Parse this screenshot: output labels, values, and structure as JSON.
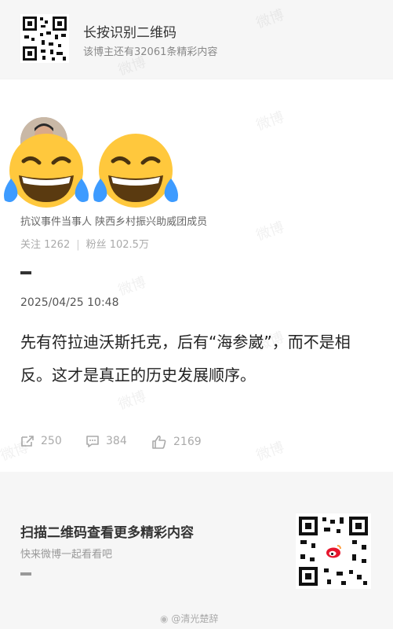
{
  "banner": {
    "title": "长按识别二维码",
    "subtitle": "该博主还有32061条精彩内容"
  },
  "post": {
    "profile_desc": "抗议事件当事人 陕西乡村振兴助威团成员",
    "follow_label": "关注 1262",
    "fans_label": "粉丝 102.5万",
    "date": "2025/04/25 10:48",
    "content": "先有符拉迪沃斯托克，后有“海参崴”，而不是相反。这才是真正的历史发展顺序。",
    "repost_count": "250",
    "comment_count": "384",
    "like_count": "2169"
  },
  "bottom": {
    "title": "扫描二维码查看更多精彩内容",
    "subtitle": "快来微博一起看看吧",
    "watermark": "@清光楚辞"
  },
  "watermark_text": "微博",
  "icons": [
    "qr-code-icon",
    "avatar",
    "laughing-tears-emoji",
    "repost-icon",
    "comment-icon",
    "like-icon",
    "weibo-logo-icon"
  ],
  "colors": {
    "page_bg": "#f2f2f2",
    "card_bg": "#ffffff",
    "emoji_yellow": "#ffc83d",
    "tears_blue": "#3d9bff"
  }
}
